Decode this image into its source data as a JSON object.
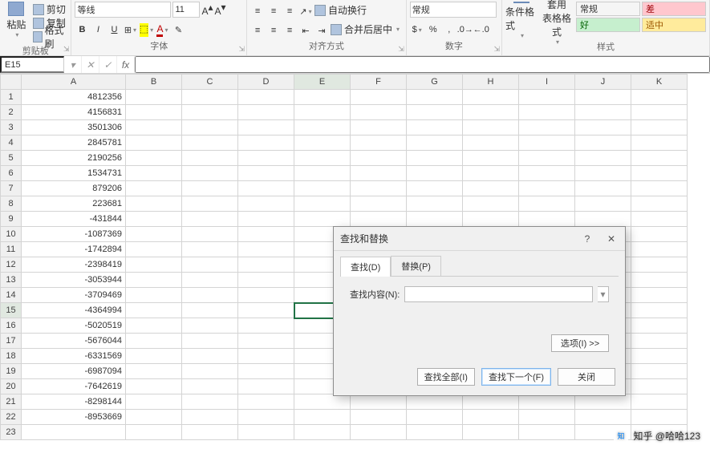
{
  "ribbon": {
    "clipboard": {
      "paste": "粘贴",
      "cut": "剪切",
      "copy": "复制",
      "format_painter": "格式刷",
      "group_label": "剪贴板"
    },
    "font": {
      "name": "等线",
      "size": "11",
      "bold": "B",
      "italic": "I",
      "underline": "U",
      "group_label": "字体"
    },
    "align": {
      "wrap": "自动换行",
      "merge": "合并后居中",
      "group_label": "对齐方式"
    },
    "number": {
      "format": "常规",
      "group_label": "数字"
    },
    "styles": {
      "cond_fmt": "条件格式",
      "table_fmt": "套用\n表格格式",
      "normal": "常规",
      "good": "好",
      "bad": "差",
      "neutral": "适中",
      "group_label": "样式"
    }
  },
  "namebox": "E15",
  "columns": [
    "A",
    "B",
    "C",
    "D",
    "E",
    "F",
    "G",
    "H",
    "I",
    "J",
    "K"
  ],
  "rows": [
    {
      "n": 1,
      "a": "4812356"
    },
    {
      "n": 2,
      "a": "4156831"
    },
    {
      "n": 3,
      "a": "3501306"
    },
    {
      "n": 4,
      "a": "2845781"
    },
    {
      "n": 5,
      "a": "2190256"
    },
    {
      "n": 6,
      "a": "1534731"
    },
    {
      "n": 7,
      "a": "879206"
    },
    {
      "n": 8,
      "a": "223681"
    },
    {
      "n": 9,
      "a": "-431844"
    },
    {
      "n": 10,
      "a": "-1087369"
    },
    {
      "n": 11,
      "a": "-1742894"
    },
    {
      "n": 12,
      "a": "-2398419"
    },
    {
      "n": 13,
      "a": "-3053944"
    },
    {
      "n": 14,
      "a": "-3709469"
    },
    {
      "n": 15,
      "a": "-4364994"
    },
    {
      "n": 16,
      "a": "-5020519"
    },
    {
      "n": 17,
      "a": "-5676044"
    },
    {
      "n": 18,
      "a": "-6331569"
    },
    {
      "n": 19,
      "a": "-6987094"
    },
    {
      "n": 20,
      "a": "-7642619"
    },
    {
      "n": 21,
      "a": "-8298144"
    },
    {
      "n": 22,
      "a": "-8953669"
    },
    {
      "n": 23,
      "a": ""
    }
  ],
  "selected_cell": {
    "row": 15,
    "col": "E"
  },
  "dialog": {
    "title": "查找和替换",
    "tab_find": "查找(D)",
    "tab_replace": "替换(P)",
    "find_label": "查找内容(N):",
    "find_value": "",
    "options": "选项(I) >>",
    "find_all": "查找全部(I)",
    "find_next": "查找下一个(F)",
    "close": "关闭",
    "help": "?"
  },
  "watermark": "知乎 @哈哈123"
}
